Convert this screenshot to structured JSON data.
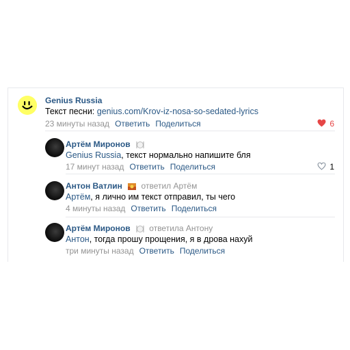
{
  "comments": [
    {
      "author": "Genius Russia",
      "text_prefix": "Текст песни: ",
      "text_link": "genius.com/Krov-iz-nosa-so-sedated-lyrics",
      "time": "23 минуты назад",
      "reply": "Ответить",
      "share": "Поделиться",
      "likes": "6",
      "liked": true
    },
    {
      "author": "Артём Миронов",
      "mention": "Genius Russia",
      "text": ", текст нормально напишите бля",
      "time": "17 минут назад",
      "reply": "Ответить",
      "share": "Поделиться",
      "likes": "1",
      "liked": false
    },
    {
      "author": "Антон Ватлин",
      "replied_to": "ответил Артём",
      "mention": "Артём",
      "text": ", я лично им текст отправил, ты чего",
      "time": "4 минуты назад",
      "reply": "Ответить",
      "share": "Поделиться"
    },
    {
      "author": "Артём Миронов",
      "replied_to": "ответила Антону",
      "mention": "Антон",
      "text": ", тогда прошу прощения, я в дрова нахуй",
      "time": "три минуты назад",
      "reply": "Ответить",
      "share": "Поделиться"
    }
  ],
  "colors": {
    "link": "#2a5885",
    "muted": "#939393",
    "heart": "#e64646",
    "divider": "#e7e8ec"
  },
  "icons": [
    "genius-smiley-avatar",
    "user-avatar",
    "user-avatar",
    "user-avatar",
    "heart-filled-icon",
    "heart-outline-icon",
    "plate-badge-icon",
    "flag-badge-icon"
  ]
}
